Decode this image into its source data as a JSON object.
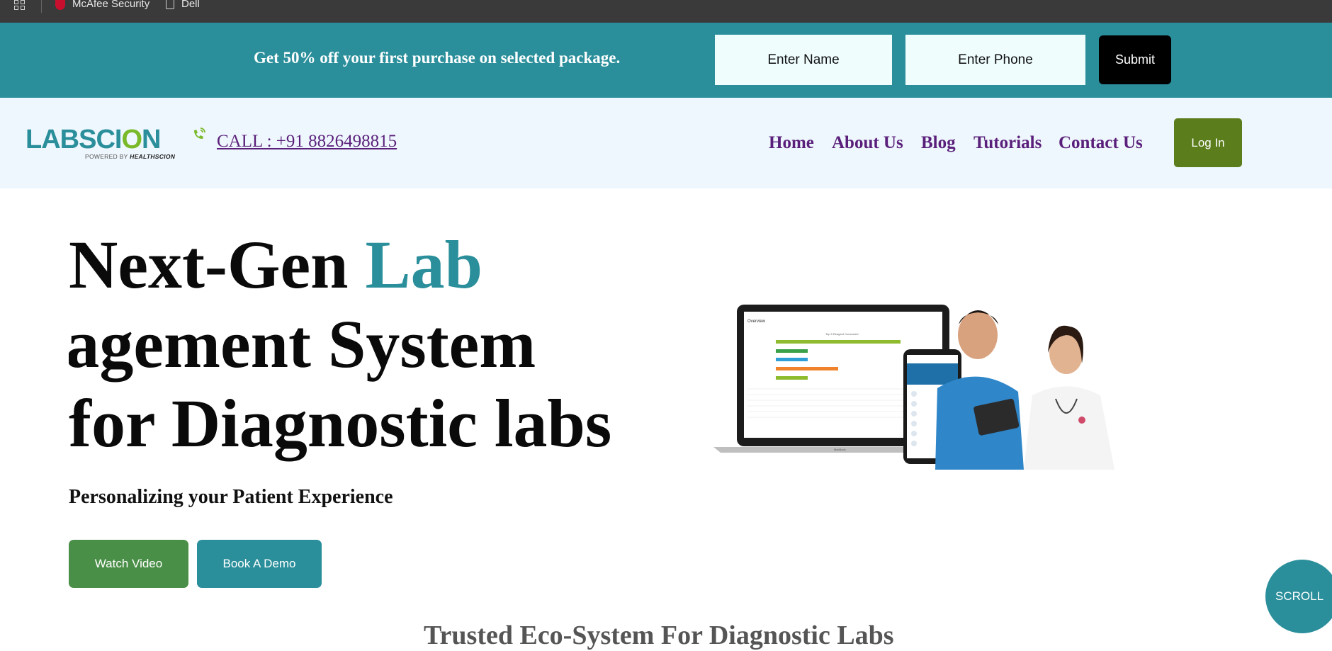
{
  "bookmarks": {
    "items": [
      {
        "label": "McAfee Security",
        "icon": "shield-icon"
      },
      {
        "label": "Dell",
        "icon": "file-icon"
      }
    ]
  },
  "promo": {
    "text": "Get 50% off your first purchase on selected package.",
    "name_placeholder": "Enter Name",
    "phone_placeholder": "Enter Phone",
    "submit_label": "Submit",
    "background": "#2a8f9b"
  },
  "header": {
    "logo": {
      "part1": "LAB",
      "part2": "SCI",
      "part3": "O",
      "part4": "N",
      "sub": "POWERED BY",
      "sub_brand": "HEALTHSCION"
    },
    "call_text": "CALL : +91 8826498815",
    "nav": [
      "Home",
      "About Us",
      "Blog",
      "Tutorials",
      "Contact Us"
    ],
    "login_label": "Log In"
  },
  "hero": {
    "title_line1_a": "Next-Gen ",
    "title_line1_b": "Lab",
    "title_line2": "nagement System",
    "title_line3": "for Diagnostic labs",
    "subtitle": "Personalizing your Patient Experience",
    "watch_label": "Watch Video",
    "demo_label": "Book A Demo",
    "image": {
      "screen_title": "Overview",
      "chart_title": "Top 5 Reagent Consumed",
      "laptop_label": "MacBook"
    }
  },
  "section": {
    "trusted_heading": "Trusted Eco-System For Diagnostic Labs"
  },
  "scroll_label": "SCROLL",
  "colors": {
    "teal": "#2a8f9b",
    "purple": "#5a1f7a",
    "green": "#5b7d1c",
    "watch_green": "#4a8f47"
  }
}
